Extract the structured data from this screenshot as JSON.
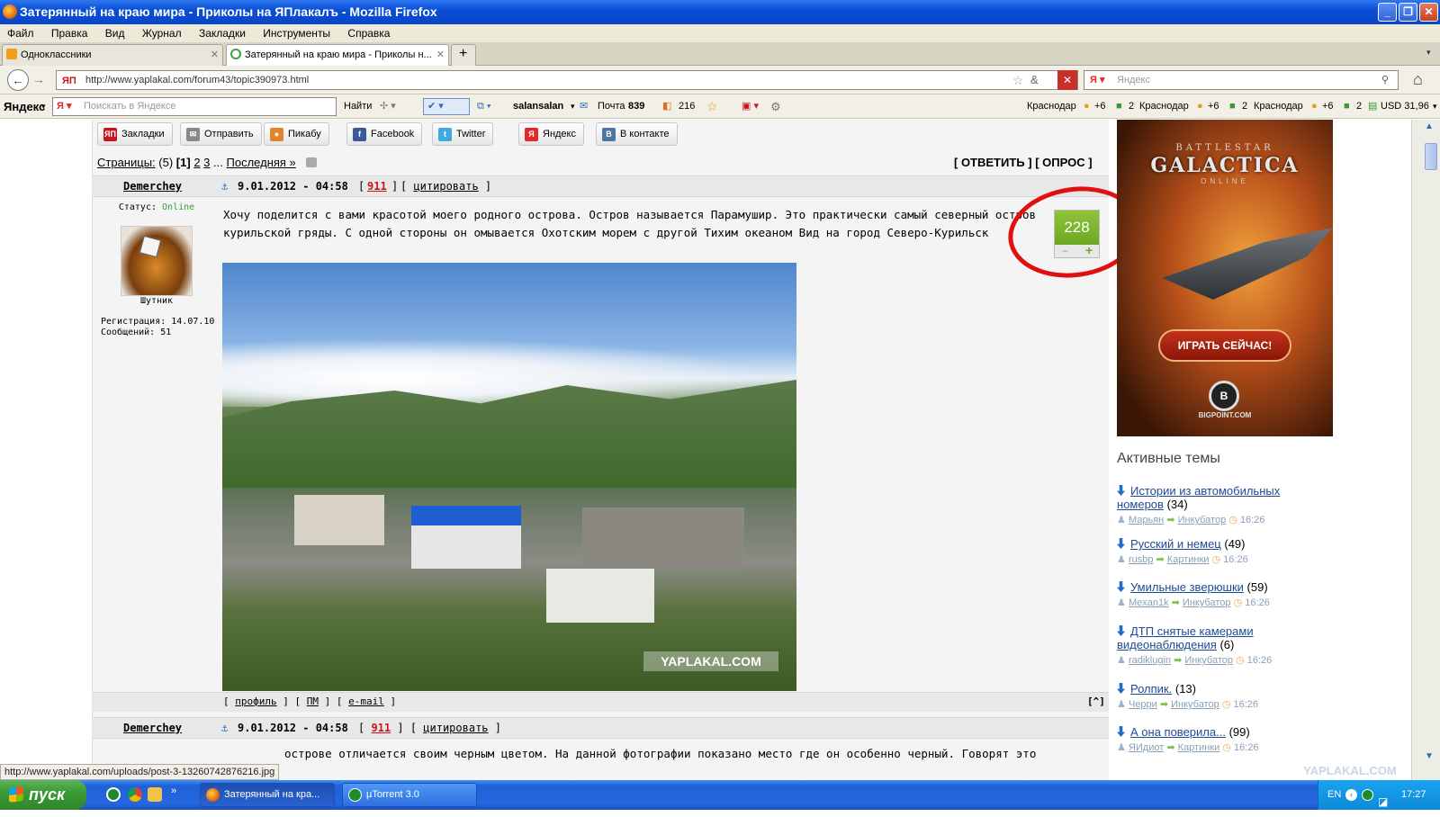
{
  "window": {
    "title": "Затерянный на краю мира - Приколы на ЯПлакалъ - Mozilla Firefox"
  },
  "menu": [
    "Файл",
    "Правка",
    "Вид",
    "Журнал",
    "Закладки",
    "Инструменты",
    "Справка"
  ],
  "tabs": [
    {
      "label": "Одноклассники"
    },
    {
      "label": "Затерянный на краю мира - Приколы н..."
    }
  ],
  "nav": {
    "url": "http://www.yaplakal.com/forum43/topic390973.html",
    "search_placeholder": "Яндекс"
  },
  "yandex_bar": {
    "logo": "Яндекс",
    "search_placeholder": "Поискать в Яндексе",
    "find_label": "Найти",
    "user": "salansalan",
    "mail_label": "Почта",
    "mail_count": "839",
    "counter2": "216",
    "weather": [
      {
        "city": "Краснодар",
        "temp": "+6",
        "extra": "2"
      },
      {
        "city": "Краснодар",
        "temp": "+6",
        "extra": "2"
      },
      {
        "city": "Краснодар",
        "temp": "+6",
        "extra": "2"
      }
    ],
    "currency": "USD 31,96"
  },
  "share": [
    {
      "label": "Закладки",
      "icon": "ЯП",
      "color": "#c8161d"
    },
    {
      "label": "Отправить",
      "icon": "✉",
      "color": "#888888"
    },
    {
      "label": "Пикабу",
      "icon": "●",
      "color": "#e0862a"
    },
    {
      "label": "Facebook",
      "icon": "f",
      "color": "#3b5998"
    },
    {
      "label": "Twitter",
      "icon": "t",
      "color": "#3fa9e0"
    },
    {
      "label": "Яндекс",
      "icon": "Я",
      "color": "#e22a2a"
    },
    {
      "label": "В контакте",
      "icon": "B",
      "color": "#4c75a3"
    }
  ],
  "pagination": {
    "label": "Страницы:",
    "count": "(5)",
    "current": "[1]",
    "p2": "2",
    "p3": "3",
    "ellipsis": "...",
    "last": "Последняя »"
  },
  "actions": {
    "reply": "[ ОТВЕТИТЬ ]",
    "poll": "[ ОПРОС ]"
  },
  "post": {
    "author": "Demerchey",
    "date": "9.01.2012 - 04:58",
    "num_open": "[",
    "num": "911",
    "num_close": "]",
    "quote": "цитировать",
    "status_label": "Статус:",
    "status": "Online",
    "rank": "Шутник",
    "reg": "Регистрация: 14.07.10",
    "msgs": "Сообщений: 51",
    "text1": "Хочу поделится с вами красотой моего родного острова. Остров называется Парамушир. Это практически самый северный остров",
    "text2": "курильской гряды. С одной стороны он омывается Охотским морем с другой Тихим океаном Вид на город Северо-Курильск",
    "rating": "228",
    "watermark": "YAPLAKAL.COM",
    "links": [
      "профиль",
      "ПМ",
      "e-mail"
    ],
    "up": "[^]"
  },
  "post2": {
    "author": "Demerchey",
    "date": "9.01.2012 - 04:58",
    "num": "911",
    "quote": "цитировать",
    "text": "острове отличается своим черным цветом. На данной фотографии показано место где он особенно черный. Говорят это"
  },
  "ad": {
    "brand": "BATTLESTAR",
    "title": "GALACTICA",
    "sub": "ONLINE",
    "button": "ИГРАТЬ СЕЙЧАС!",
    "footer": "BIGPOINT.COM"
  },
  "active_topics": {
    "heading": "Активные темы",
    "items": [
      {
        "title": "Истории из автомобильных номеров",
        "count": "(34)",
        "user": "Марьян",
        "section": "Инкубатор",
        "time": "16:26"
      },
      {
        "title": "Русский и немец",
        "count": "(49)",
        "user": "rusbp",
        "section": "Картинки",
        "time": "16:26"
      },
      {
        "title": "Умильные зверюшки",
        "count": "(59)",
        "user": "Mexan1k",
        "section": "Инкубатор",
        "time": "16:26"
      },
      {
        "title": "ДТП снятые камерами видеонаблюдения",
        "count": "(6)",
        "user": "radiklugin",
        "section": "Инкубатор",
        "time": "16:26"
      },
      {
        "title": "Ролпик.",
        "count": "(13)",
        "user": "Черри",
        "section": "Инкубатор",
        "time": "16:26"
      },
      {
        "title": "А она поверила...",
        "count": "(99)",
        "user": "ЯИдиот",
        "section": "Картинки",
        "time": "16:26"
      }
    ]
  },
  "status_url": "http://www.yaplakal.com/uploads/post-3-13260742876216.jpg",
  "taskbar": {
    "start": "пуск",
    "windows": [
      "Затерянный на кра...",
      "µTorrent 3.0"
    ],
    "lang": "EN",
    "clock": "17:27"
  },
  "corner_watermark": "YAPLAKAL.COM",
  "colors": {
    "accent_red": "#c8161d",
    "rating_green": "#7db52a",
    "link_blue": "#1e4a94"
  }
}
